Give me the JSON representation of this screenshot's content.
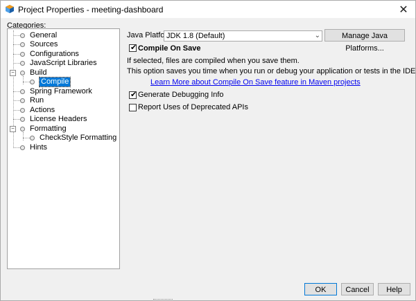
{
  "window": {
    "title": "Project Properties - meeting-dashboard"
  },
  "tree": {
    "label": "Categories:",
    "items": [
      {
        "label": "General"
      },
      {
        "label": "Sources"
      },
      {
        "label": "Configurations"
      },
      {
        "label": "JavaScript Libraries"
      },
      {
        "label": "Build"
      },
      {
        "label": "Compile"
      },
      {
        "label": "Spring Framework"
      },
      {
        "label": "Run"
      },
      {
        "label": "Actions"
      },
      {
        "label": "License Headers"
      },
      {
        "label": "Formatting"
      },
      {
        "label": "CheckStyle Formatting"
      },
      {
        "label": "Hints"
      }
    ],
    "selected": "Compile"
  },
  "panel": {
    "java_platform_label": "Java Platform:",
    "java_platform_value": "JDK 1.8 (Default)",
    "manage_button": "Manage Java Platforms...",
    "compile_on_save": {
      "label": "Compile On Save",
      "checked": true
    },
    "desc1": "If selected, files are compiled when you save them.",
    "desc2": "This option saves you time when you run or debug your application or tests in the IDE.",
    "learn_more_link": "Learn More about Compile On Save feature in Maven projects",
    "debug_info": {
      "label": "Generate Debugging Info",
      "checked": true
    },
    "deprecated": {
      "label": "Report Uses of Deprecated APIs",
      "checked": false
    }
  },
  "buttons": {
    "ok": "OK",
    "cancel": "Cancel",
    "help": "Help"
  },
  "icons": {
    "app": "netbeans-cube-icon",
    "close": "close-icon",
    "dropdown": "chevron-down-icon"
  }
}
